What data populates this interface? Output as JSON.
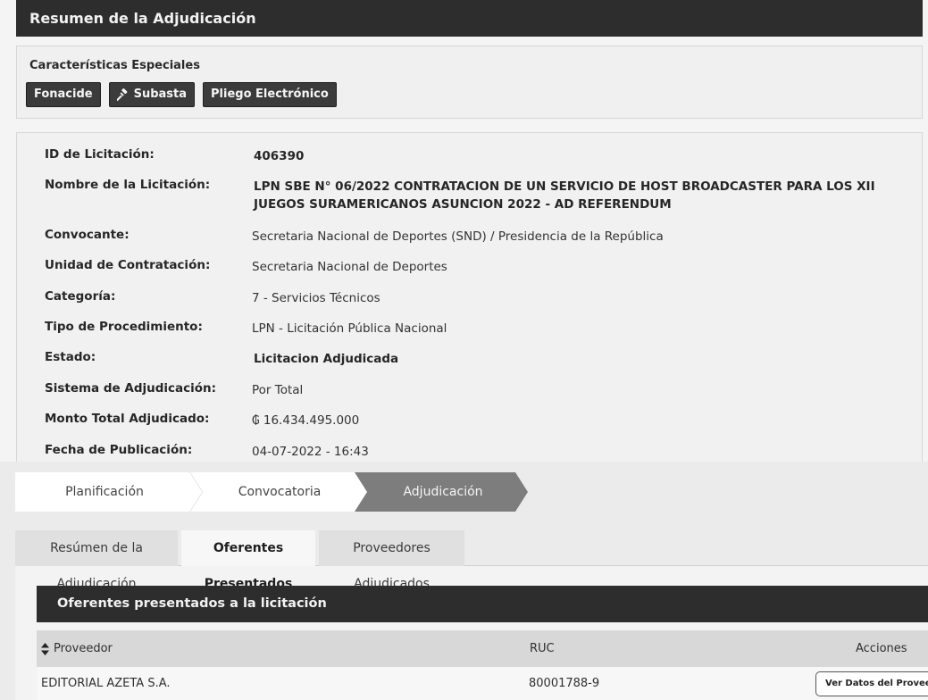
{
  "header": {
    "title": "Resumen de la Adjudicación"
  },
  "special": {
    "title": "Características Especiales",
    "badges": [
      "Fonacide",
      "Subasta",
      "Pliego Electrónico"
    ]
  },
  "details": {
    "id_label": "ID de Licitación:",
    "id_value": "406390",
    "name_label": "Nombre de la Licitación:",
    "name_value": "LPN SBE N° 06/2022 CONTRATACION DE UN SERVICIO DE HOST BROADCASTER PARA LOS XII JUEGOS SURAMERICANOS ASUNCION 2022 - AD REFERENDUM",
    "convocante_label": "Convocante:",
    "convocante_value": "Secretaria Nacional de Deportes (SND) / Presidencia de la República",
    "unidad_label": "Unidad de Contratación:",
    "unidad_value": "Secretaria Nacional de Deportes",
    "categoria_label": "Categoría:",
    "categoria_value": "7 - Servicios Técnicos",
    "tipo_label": "Tipo de Procedimiento:",
    "tipo_value": "LPN - Licitación Pública Nacional",
    "estado_label": "Estado:",
    "estado_value": "Licitacion Adjudicada",
    "sistema_label": "Sistema de Adjudicación:",
    "sistema_value": "Por Total",
    "monto_label": "Monto Total Adjudicado:",
    "monto_value": "₲ 16.434.495.000",
    "fecha_label": "Fecha de Publicación:",
    "fecha_value": "04-07-2022 - 16:43"
  },
  "steps": [
    "Planificación",
    "Convocatoria",
    "Adjudicación"
  ],
  "tabs": [
    "Resúmen de la Adjudicación",
    "Oferentes Presentados",
    "Proveedores Adjudicados"
  ],
  "table": {
    "title": "Oferentes presentados a la licitación",
    "headers": {
      "proveedor": "Proveedor",
      "ruc": "RUC",
      "acciones": "Acciones"
    },
    "rows": [
      {
        "proveedor": "EDITORIAL AZETA S.A.",
        "ruc": "80001788-9",
        "action": "Ver Datos del Proveedor"
      }
    ]
  }
}
